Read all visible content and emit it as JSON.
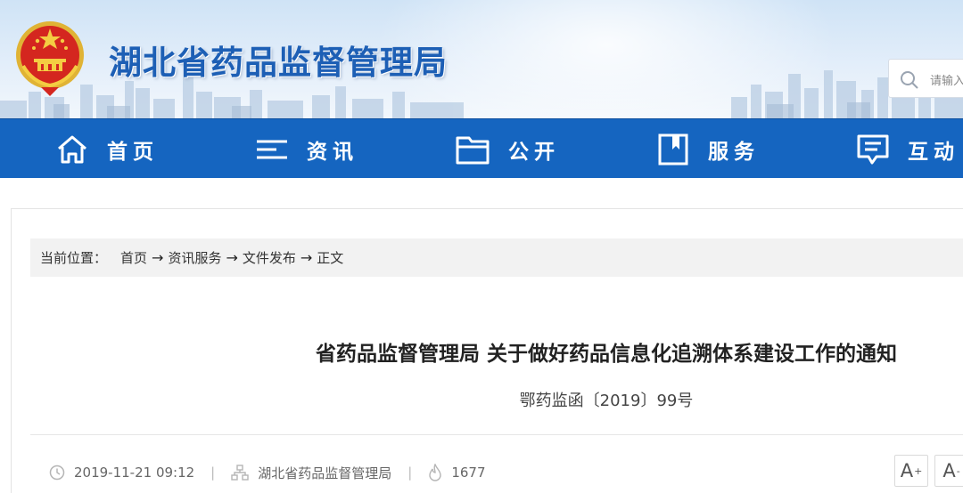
{
  "header": {
    "site_title": "湖北省药品监督管理局",
    "search_placeholder": "请输入",
    "emblem_icon": "national-emblem-icon"
  },
  "nav": {
    "items": [
      {
        "label": "首页",
        "icon": "home-icon"
      },
      {
        "label": "资讯",
        "icon": "news-list-icon"
      },
      {
        "label": "公开",
        "icon": "folder-icon"
      },
      {
        "label": "服务",
        "icon": "bookmark-icon"
      },
      {
        "label": "互动",
        "icon": "chat-icon"
      }
    ],
    "background": "#1565c0"
  },
  "breadcrumb": {
    "location_label": "当前位置：",
    "items": [
      "首页",
      "资讯服务",
      "文件发布",
      "正文"
    ],
    "separator": "→"
  },
  "article": {
    "title": "省药品监督管理局 关于做好药品信息化追溯体系建设工作的通知",
    "doc_number": "鄂药监函〔2019〕99号",
    "date": "2019-11-21 09:12",
    "source": "湖北省药品监督管理局",
    "views": "1677"
  },
  "font_controls": {
    "increase": "A",
    "increase_mark": "+",
    "decrease": "A",
    "decrease_mark": "-"
  }
}
